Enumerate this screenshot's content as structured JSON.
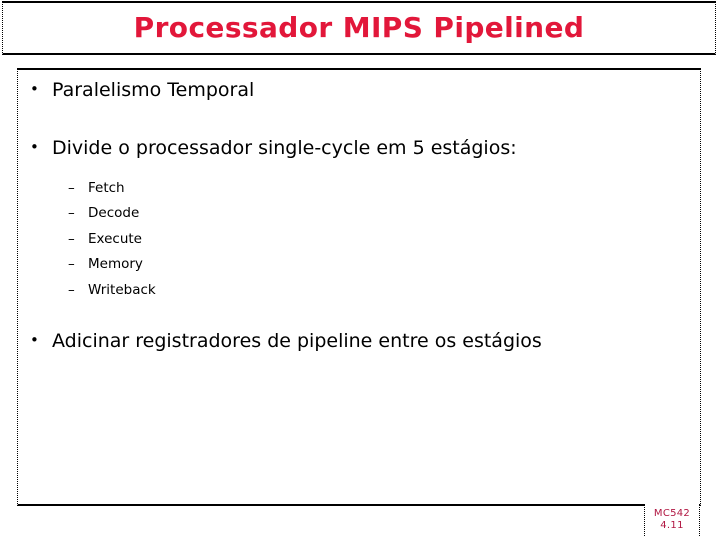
{
  "slide": {
    "title": "Processador MIPS Pipelined",
    "title_color": "#e2173a",
    "background_color": "#ffffff",
    "text_color": "#000000",
    "border_color": "#000000"
  },
  "body": {
    "bullet_marker": "•",
    "sub_bullet_marker": "–",
    "bullets": [
      {
        "text": "Paralelismo Temporal"
      },
      {
        "text": "Divide o processador  single-cycle em 5 estágios:"
      },
      {
        "text": "Adicinar registradores de pipeline entre os estágios"
      }
    ],
    "stages": [
      "Fetch",
      "Decode",
      "Execute",
      "Memory",
      "Writeback"
    ]
  },
  "footer": {
    "course_code": "MC542",
    "slide_number": "4.11",
    "color": "#b01641"
  }
}
